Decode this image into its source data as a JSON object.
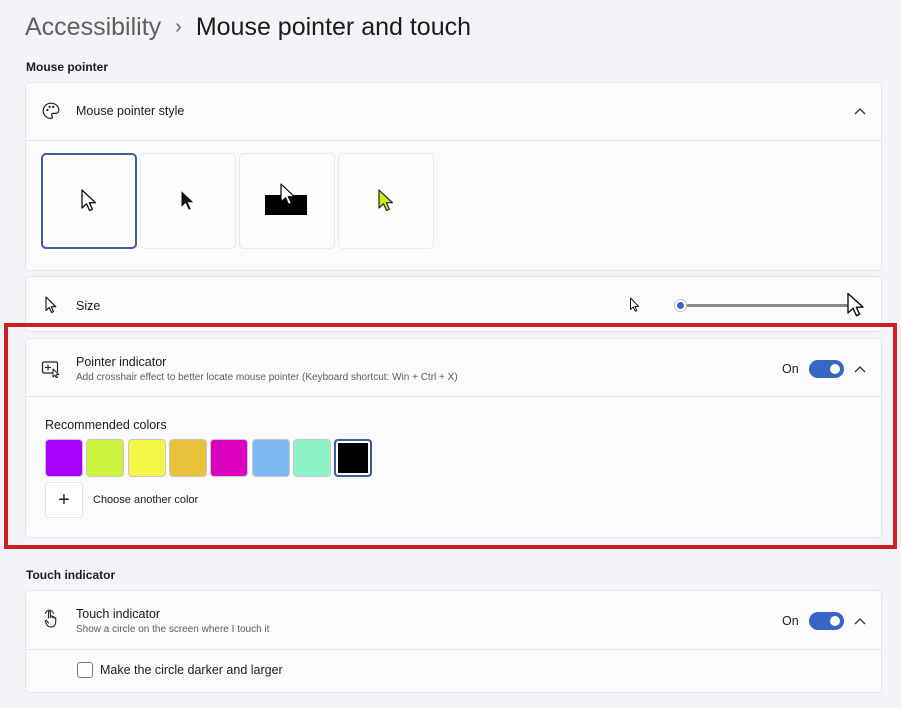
{
  "breadcrumb": {
    "parent": "Accessibility",
    "separator": "›",
    "current": "Mouse pointer and touch"
  },
  "mouse_pointer_section": {
    "title": "Mouse pointer"
  },
  "pointer_style": {
    "title": "Mouse pointer style",
    "icon": "palette-icon",
    "options": [
      {
        "name": "white",
        "selected": true
      },
      {
        "name": "black",
        "selected": false
      },
      {
        "name": "inverted",
        "selected": false
      },
      {
        "name": "custom",
        "color": "#c8f01f",
        "selected": false
      }
    ]
  },
  "size": {
    "title": "Size",
    "icon": "pointer-icon",
    "value": 0.0
  },
  "pointer_indicator": {
    "title": "Pointer indicator",
    "subtitle": "Add crosshair effect to better locate mouse pointer (Keyboard shortcut: Win + Ctrl + X)",
    "toggle_label": "On",
    "toggle_on": true,
    "recommended_label": "Recommended colors",
    "colors": [
      "#aa00ff",
      "#ccf33c",
      "#f5f547",
      "#e8c13a",
      "#de00c0",
      "#7db8f5",
      "#8ff2c4",
      "#000000"
    ],
    "selected_color": "#000000",
    "choose_label": "Choose another color",
    "add_symbol": "+"
  },
  "touch_section": {
    "title": "Touch indicator"
  },
  "touch_indicator": {
    "title": "Touch indicator",
    "subtitle": "Show a circle on the screen where I touch it",
    "toggle_label": "On",
    "toggle_on": true,
    "checkbox_label": "Make the circle darker and larger",
    "checkbox_checked": false
  }
}
